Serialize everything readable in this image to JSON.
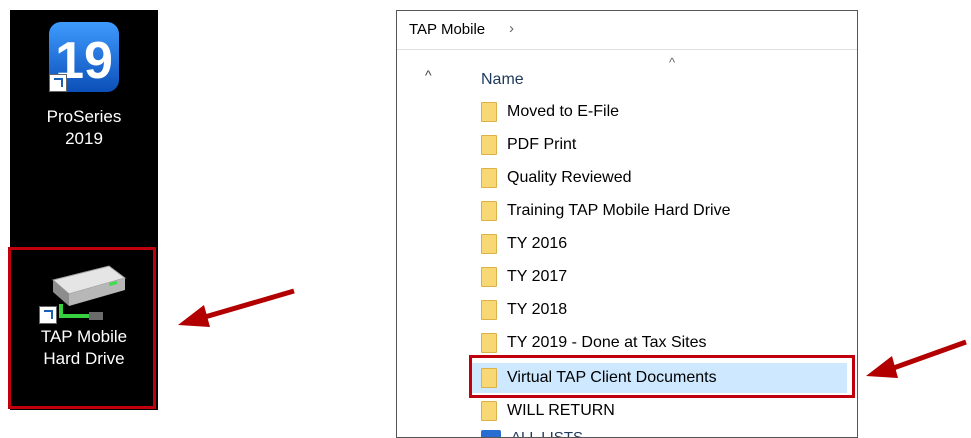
{
  "desktop": {
    "proseries": {
      "line1": "ProSeries",
      "line2": "2019",
      "tile_text": "19"
    },
    "tap_drive": {
      "line1": "TAP Mobile",
      "line2": "Hard Drive"
    }
  },
  "explorer": {
    "breadcrumb": "TAP Mobile",
    "breadcrumb_sep": "›",
    "column_header": "Name",
    "rows": [
      "Moved to E-File",
      "PDF Print",
      "Quality Reviewed",
      "Training TAP Mobile Hard Drive",
      "TY 2016",
      "TY 2017",
      "TY 2018",
      "TY 2019 - Done at Tax Sites",
      "Virtual TAP Client Documents",
      "WILL RETURN"
    ],
    "selected_row": "Virtual TAP Client Documents",
    "partial_row": "ALL LISTS"
  },
  "colors": {
    "highlight": "#c0000c",
    "selection": "#cde8ff",
    "folder": "#f8d775",
    "proseries_tile": "#1f7ae0"
  }
}
